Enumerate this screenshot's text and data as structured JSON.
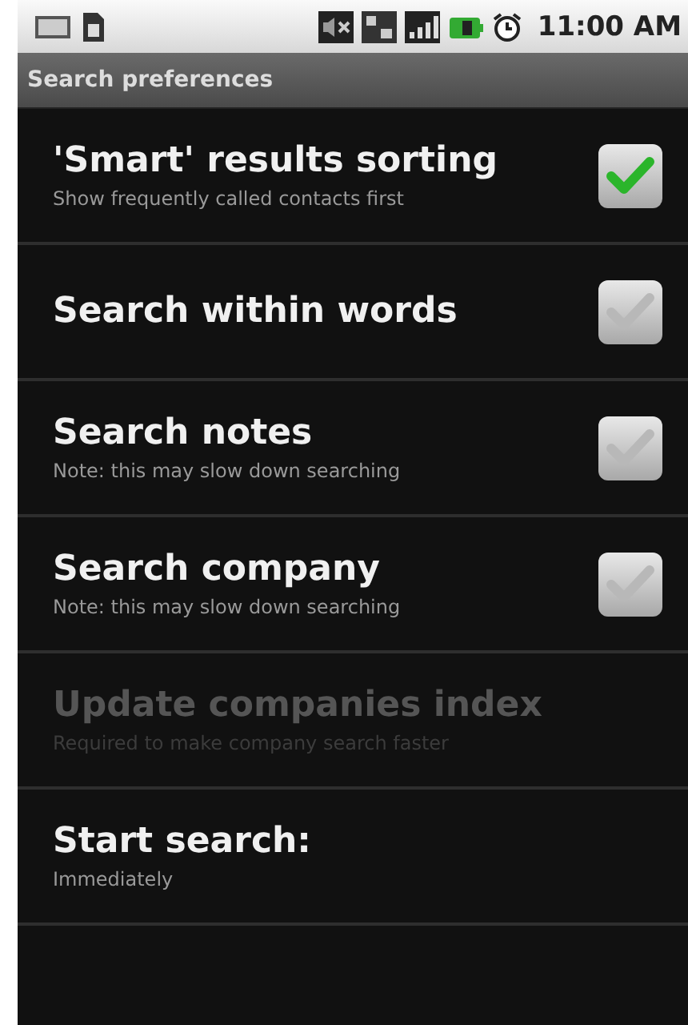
{
  "status_bar": {
    "time": "11:00 AM"
  },
  "title": "Search preferences",
  "preferences": [
    {
      "kind": "checkbox",
      "title": "'Smart' results sorting",
      "summary": "Show frequently called contacts first",
      "checked": true,
      "disabled": false
    },
    {
      "kind": "checkbox",
      "title": "Search within words",
      "checked": false,
      "disabled": false
    },
    {
      "kind": "checkbox",
      "title": "Search notes",
      "summary": "Note: this may slow down searching",
      "checked": false,
      "disabled": false
    },
    {
      "kind": "checkbox",
      "title": "Search company",
      "summary": "Note: this may slow down searching",
      "checked": false,
      "disabled": false
    },
    {
      "kind": "action",
      "title": "Update companies index",
      "summary": "Required to make company search faster",
      "disabled": true
    },
    {
      "kind": "action",
      "title": "Start search:",
      "summary": "Immediately",
      "disabled": false
    }
  ]
}
